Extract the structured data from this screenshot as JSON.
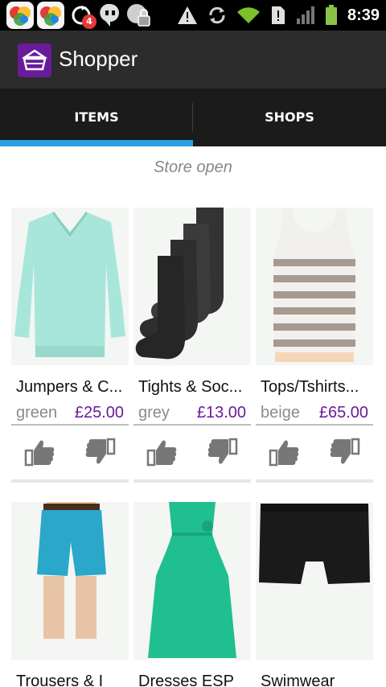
{
  "status_bar": {
    "notification_count": "4",
    "time": "8:39"
  },
  "app": {
    "title": "Shopper",
    "brand_color": "#6a1b9a",
    "accent_color": "#2aa0de"
  },
  "tabs": [
    {
      "label": "ITEMS",
      "selected": true
    },
    {
      "label": "SHOPS",
      "selected": false
    }
  ],
  "store_status": "Store open",
  "items": [
    {
      "title": "Jumpers & C...",
      "color": "green",
      "price": "£25.00",
      "icon": "sweater-icon"
    },
    {
      "title": "Tights & Soc...",
      "color": "grey",
      "price": "£13.00",
      "icon": "socks-icon"
    },
    {
      "title": "Tops/Tshirts...",
      "color": "beige",
      "price": "£65.00",
      "icon": "tank-top-icon"
    },
    {
      "title": "Trousers & I",
      "color": "",
      "price": "",
      "icon": "shorts-icon"
    },
    {
      "title": "Dresses ESP",
      "color": "",
      "price": "",
      "icon": "dress-icon"
    },
    {
      "title": "Swimwear",
      "color": "",
      "price": "",
      "icon": "swim-shorts-icon"
    }
  ]
}
